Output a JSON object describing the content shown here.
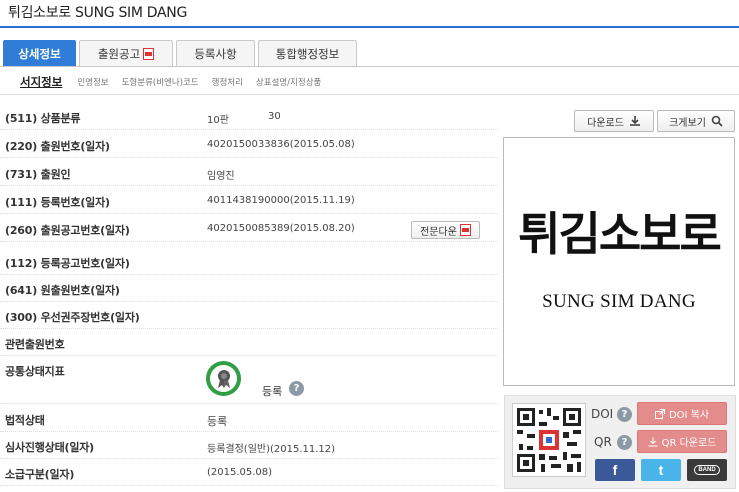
{
  "page": {
    "title": "튀김소보로 SUNG SIM DANG"
  },
  "tabs": [
    {
      "label": "상세정보",
      "active": true
    },
    {
      "label": "출원공고",
      "pdf": true
    },
    {
      "label": "등록사항"
    },
    {
      "label": "통합행정정보"
    }
  ],
  "subtabs": [
    "서지정보",
    "인명정보",
    "도형분류(비엔나)코드",
    "행정처리",
    "상표설명/지정상품"
  ],
  "fields": {
    "class": {
      "label": "(511) 상품분류",
      "value": "10판",
      "value2": "30"
    },
    "app_no": {
      "label": "(220) 출원번호(일자)",
      "value": "4020150033836(2015.05.08)"
    },
    "applicant": {
      "label": "(731) 출원인",
      "value": "임영진"
    },
    "reg_no": {
      "label": "(111) 등록번호(일자)",
      "value": "4011438190000(2015.11.19)"
    },
    "pub_no": {
      "label": "(260) 출원공고번호(일자)",
      "value": "4020150085389(2015.08.20)",
      "button": "전문다운"
    },
    "reg_pub_no": {
      "label": "(112) 등록공고번호(일자)",
      "value": ""
    },
    "orig_app_no": {
      "label": "(641) 원출원번호(일자)",
      "value": ""
    },
    "priority": {
      "label": "(300) 우선권주장번호(일자)",
      "value": ""
    },
    "related": {
      "label": "관련출원번호",
      "value": ""
    },
    "status_index": {
      "label": "공통상태지표",
      "value": "등록",
      "icon": "award-icon"
    },
    "legal_status": {
      "label": "법적상태",
      "value": "등록"
    },
    "exam_status": {
      "label": "심사진행상태(일자)",
      "value": "등록결정(일반)(2015.11.12)"
    },
    "retro": {
      "label": "소급구분(일자)",
      "value": "(2015.05.08)"
    }
  },
  "toolbar": {
    "download": "다운로드",
    "zoom": "크게보기"
  },
  "trademark": {
    "main": "튀김소보로",
    "sub": "SUNG SIM DANG"
  },
  "share": {
    "doi_label": "DOI",
    "qr_label": "QR",
    "doi_copy": "DOI 복사",
    "qr_download": "QR 다운로드",
    "sns": [
      {
        "name": "facebook",
        "glyph": "f",
        "color": "#3b5998"
      },
      {
        "name": "twitter",
        "glyph": "t",
        "color": "#4ab3e8"
      },
      {
        "name": "band",
        "glyph": "BAND",
        "color": "#3a3a3a"
      }
    ]
  },
  "colors": {
    "accent": "#2f7dd6",
    "status_green": "#2f9e44",
    "share_button": "#e48b8b"
  }
}
